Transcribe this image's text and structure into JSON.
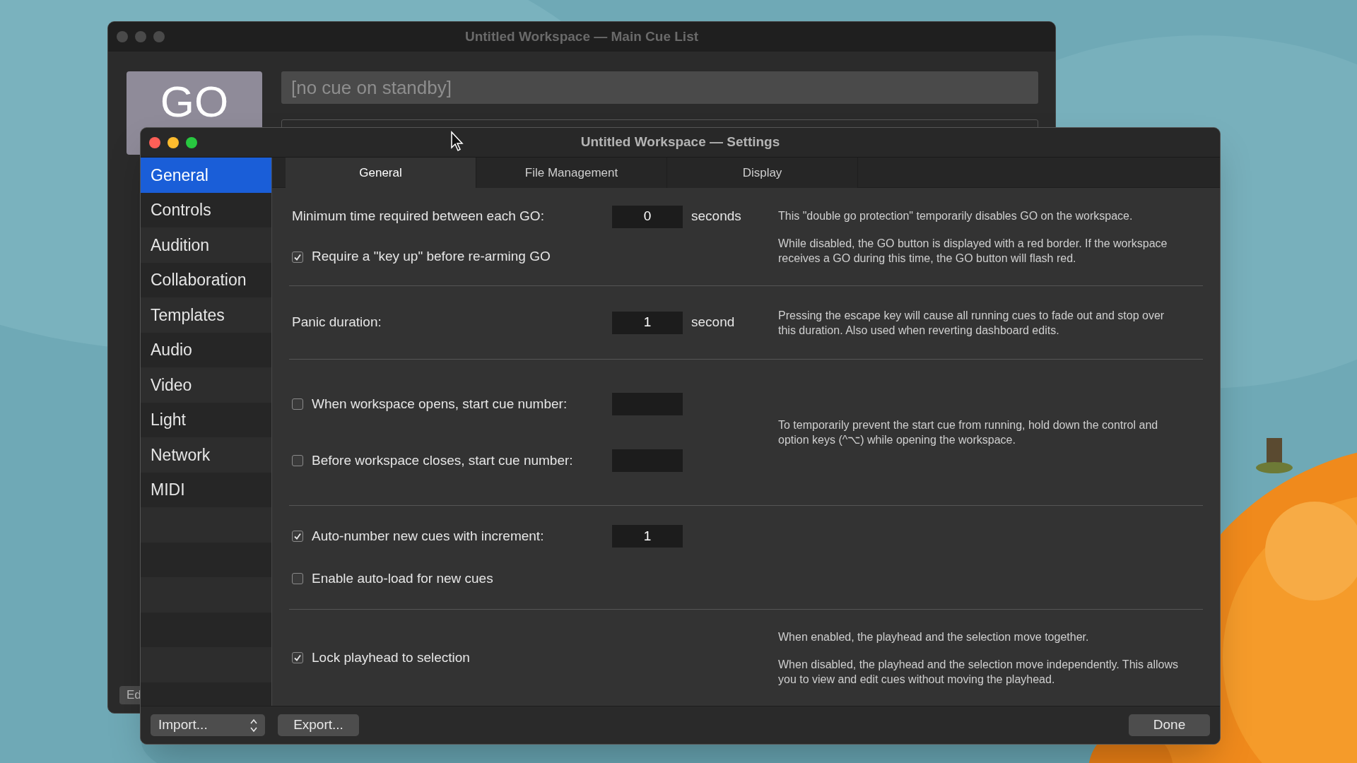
{
  "back_window": {
    "title": "Untitled Workspace — Main Cue List",
    "go_button": "GO",
    "standby": "[no cue on standby]",
    "edit_button": "Ed"
  },
  "window": {
    "title": "Untitled Workspace — Settings"
  },
  "sidebar": {
    "items": [
      {
        "label": "General",
        "selected": true
      },
      {
        "label": "Controls",
        "selected": false
      },
      {
        "label": "Audition",
        "selected": false
      },
      {
        "label": "Collaboration",
        "selected": false
      },
      {
        "label": "Templates",
        "selected": false
      },
      {
        "label": "Audio",
        "selected": false
      },
      {
        "label": "Video",
        "selected": false
      },
      {
        "label": "Light",
        "selected": false
      },
      {
        "label": "Network",
        "selected": false
      },
      {
        "label": "MIDI",
        "selected": false
      }
    ]
  },
  "tabs": [
    {
      "label": "General",
      "selected": true
    },
    {
      "label": "File Management",
      "selected": false
    },
    {
      "label": "Display",
      "selected": false
    }
  ],
  "sections": [
    {
      "rows": [
        {
          "kind": "field",
          "label": "Minimum time required between each GO:",
          "value": "0",
          "unit": "seconds"
        },
        {
          "kind": "checkbox",
          "label": "Require a \"key up\" before re-arming GO",
          "checked": true
        }
      ],
      "notes": [
        "This \"double go protection\" temporarily disables GO on the workspace.",
        "While disabled, the GO button is displayed with a red border. If the workspace receives a GO during this time, the GO button will flash red."
      ]
    },
    {
      "rows": [
        {
          "kind": "field",
          "label": "Panic duration:",
          "value": "1",
          "unit": "second"
        }
      ],
      "notes": [
        "Pressing the escape key will cause all running cues to fade out and stop over this duration. Also used when reverting dashboard edits."
      ]
    },
    {
      "rows": [
        {
          "kind": "checkbox_field",
          "label": "When workspace opens, start cue number:",
          "checked": false
        },
        {
          "kind": "checkbox_field",
          "label": "Before workspace closes, start cue number:",
          "checked": false
        }
      ],
      "notes": [
        "To temporarily prevent the start cue from running, hold down the control and option keys (^⌥) while opening the workspace."
      ]
    },
    {
      "rows": [
        {
          "kind": "checkbox_field",
          "label": "Auto-number new cues with increment:",
          "checked": true,
          "value": "1"
        },
        {
          "kind": "checkbox",
          "label": "Enable auto-load for new cues",
          "checked": false
        }
      ]
    },
    {
      "rows": [
        {
          "kind": "checkbox",
          "label": "Lock playhead to selection",
          "checked": true
        }
      ],
      "notes": [
        "When enabled, the playhead and the selection move together.",
        "When disabled, the playhead and the selection move independently. This allows you to view and edit cues without moving the playhead."
      ]
    }
  ],
  "footer": {
    "import": "Import...",
    "export": "Export...",
    "done": "Done"
  }
}
